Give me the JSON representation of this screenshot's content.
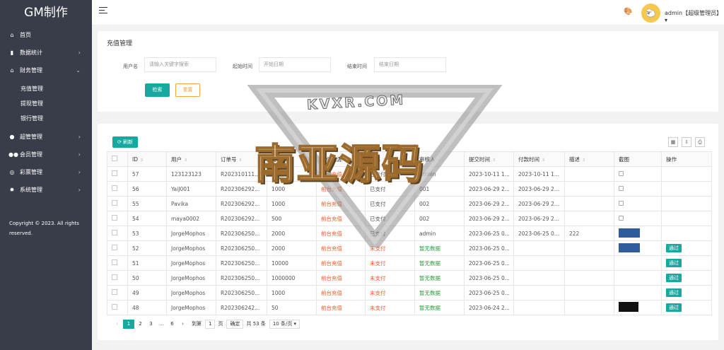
{
  "app": {
    "title": "GM制作"
  },
  "sidebar": {
    "items": [
      {
        "label": "首页",
        "icon": "home-icon",
        "arrow": ""
      },
      {
        "label": "数据统计",
        "icon": "bar-chart-icon",
        "arrow": "›"
      },
      {
        "label": "财务管理",
        "icon": "bank-icon",
        "arrow": "⌄"
      }
    ],
    "sub_items": [
      "充值管理",
      "提现管理",
      "银行管理"
    ],
    "items2": [
      {
        "label": "超管管理",
        "icon": "user-icon",
        "arrow": "›"
      },
      {
        "label": "会员管理",
        "icon": "users-icon",
        "arrow": "›"
      },
      {
        "label": "彩票管理",
        "icon": "gamepad-icon",
        "arrow": "›"
      },
      {
        "label": "系统管理",
        "icon": "gear-icon",
        "arrow": "›"
      }
    ],
    "copyright": "Copyright © 2023. All rights reserved."
  },
  "topbar": {
    "user_label": "admin【超级管理员】▾"
  },
  "search": {
    "title": "充值管理",
    "username_label": "用户名",
    "username_placeholder": "请输入关键字搜索",
    "start_label": "起始时间",
    "start_placeholder": "开始日期",
    "end_label": "结束时间",
    "end_placeholder": "结束日期",
    "search_btn": "检索",
    "reset_btn": "重置"
  },
  "toolbar": {
    "refresh": "刷新"
  },
  "table": {
    "headers": [
      "ID",
      "用户",
      "订单号",
      "金额",
      "充值来源",
      "状态",
      "审核人",
      "提交时间",
      "付款时间",
      "描述",
      "截图",
      "操作"
    ],
    "rows": [
      {
        "id": "57",
        "user": "123123123",
        "order": "R202310111...",
        "amount": "2000",
        "source": "前台充值",
        "status": "已支付",
        "reviewer": "admin",
        "submit": "2023-10-11 1...",
        "paid": "2023-10-11 1...",
        "desc": "",
        "shot": "broken",
        "action": ""
      },
      {
        "id": "56",
        "user": "YaiJ001",
        "order": "R202306292...",
        "amount": "1000",
        "source": "前台充值",
        "status": "已支付",
        "reviewer": "001",
        "submit": "2023-06-29 2...",
        "paid": "2023-06-29 2...",
        "desc": "",
        "shot": "broken",
        "action": ""
      },
      {
        "id": "55",
        "user": "Pavika",
        "order": "R202306292...",
        "amount": "1000",
        "source": "前台充值",
        "status": "已支付",
        "reviewer": "002",
        "submit": "2023-06-29 2...",
        "paid": "2023-06-29 2...",
        "desc": "",
        "shot": "broken",
        "action": ""
      },
      {
        "id": "54",
        "user": "maya0002",
        "order": "R202306292...",
        "amount": "500",
        "source": "前台充值",
        "status": "已支付",
        "reviewer": "002",
        "submit": "2023-06-29 2...",
        "paid": "2023-06-29 2...",
        "desc": "",
        "shot": "broken",
        "action": ""
      },
      {
        "id": "53",
        "user": "JorgeMophos",
        "order": "R202306250...",
        "amount": "2000",
        "source": "前台充值",
        "status": "已支付",
        "reviewer": "admin",
        "submit": "2023-06-25 0...",
        "paid": "2023-06-25 0...",
        "desc": "222",
        "shot": "blue",
        "action": ""
      },
      {
        "id": "52",
        "user": "JorgeMophos",
        "order": "R202306250...",
        "amount": "2000",
        "source": "前台充值",
        "status": "未支付",
        "reviewer": "暂无数据",
        "submit": "2023-06-25 0...",
        "paid": "",
        "desc": "",
        "shot": "blue",
        "action": "通过"
      },
      {
        "id": "51",
        "user": "JorgeMophos",
        "order": "R202306250...",
        "amount": "10000",
        "source": "前台充值",
        "status": "未支付",
        "reviewer": "暂无数据",
        "submit": "2023-06-25 0...",
        "paid": "",
        "desc": "",
        "shot": "",
        "action": "通过"
      },
      {
        "id": "50",
        "user": "JorgeMophos",
        "order": "R202306250...",
        "amount": "1000000",
        "source": "前台充值",
        "status": "未支付",
        "reviewer": "暂无数据",
        "submit": "2023-06-25 0...",
        "paid": "",
        "desc": "",
        "shot": "",
        "action": "通过"
      },
      {
        "id": "49",
        "user": "JorgeMophos",
        "order": "R202306250...",
        "amount": "1000",
        "source": "前台充值",
        "status": "未支付",
        "reviewer": "暂无数据",
        "submit": "2023-06-25 0...",
        "paid": "",
        "desc": "",
        "shot": "",
        "action": "通过"
      },
      {
        "id": "48",
        "user": "JorgeMophos",
        "order": "R202306242...",
        "amount": "50",
        "source": "前台充值",
        "status": "未支付",
        "reviewer": "暂无数据",
        "submit": "2023-06-24 2...",
        "paid": "",
        "desc": "",
        "shot": "dark",
        "action": "通过"
      }
    ]
  },
  "pager": {
    "pages": [
      "1",
      "2",
      "3",
      "…",
      "6"
    ],
    "goto": "到第",
    "page_input": "1",
    "page_unit": "页",
    "confirm": "确定",
    "total": "共 53 条",
    "size": "10 条/页 ▾"
  },
  "watermark": {
    "site": "KVXR.COM",
    "text": "南亚源码"
  },
  "colors": {
    "sidebar": "#393d49",
    "accent": "#17a89f",
    "warn": "#f0a73a",
    "danger": "#ff5722"
  }
}
